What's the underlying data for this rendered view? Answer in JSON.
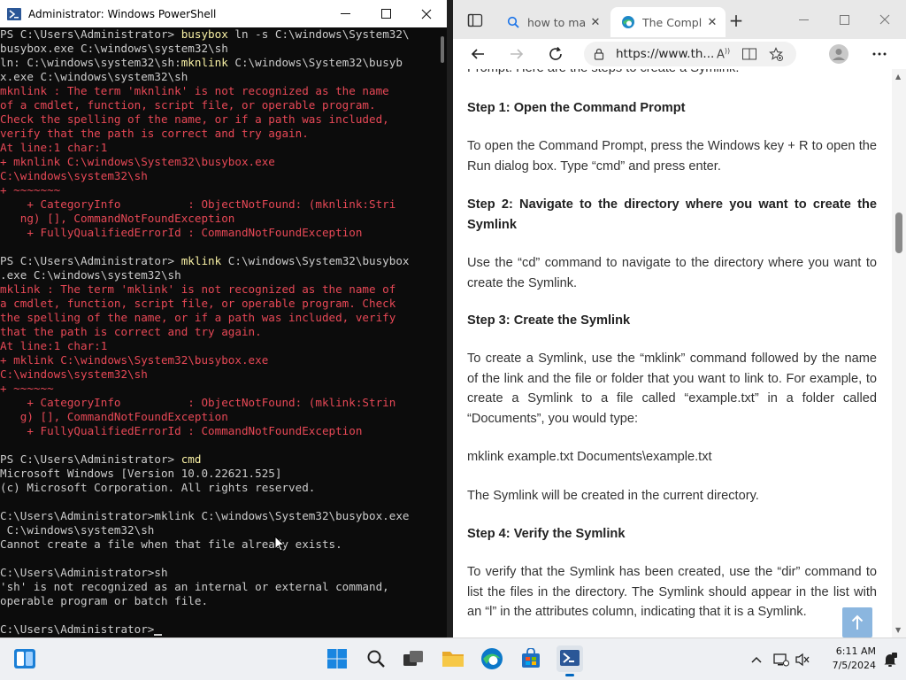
{
  "powershell": {
    "title": "Administrator: Windows PowerShell",
    "lines": [
      {
        "parts": [
          {
            "t": "PS C:\\Users\\Administrator> ",
            "c": "n"
          },
          {
            "t": "busybox ",
            "c": "y"
          },
          {
            "t": "ln -s C:\\windows\\System32\\",
            "c": "n"
          }
        ]
      },
      {
        "parts": [
          {
            "t": "busybox.exe C:\\windows\\system32\\sh",
            "c": "n"
          }
        ]
      },
      {
        "parts": [
          {
            "t": "ln: C:\\windows\\system32\\sh:",
            "c": "n"
          },
          {
            "t": "mknlink ",
            "c": "y"
          },
          {
            "t": "C:\\windows\\System32\\busyb",
            "c": "n"
          }
        ]
      },
      {
        "parts": [
          {
            "t": "x.exe C:\\windows\\system32\\sh",
            "c": "n"
          }
        ]
      },
      {
        "parts": [
          {
            "t": "mknlink : The term 'mknlink' is not recognized as the name",
            "c": "e"
          }
        ]
      },
      {
        "parts": [
          {
            "t": "of a cmdlet, function, script file, or operable program.",
            "c": "e"
          }
        ]
      },
      {
        "parts": [
          {
            "t": "Check the spelling of the name, or if a path was included,",
            "c": "e"
          }
        ]
      },
      {
        "parts": [
          {
            "t": "verify that the path is correct and try again.",
            "c": "e"
          }
        ]
      },
      {
        "parts": [
          {
            "t": "At line:1 char:1",
            "c": "e"
          }
        ]
      },
      {
        "parts": [
          {
            "t": "+ mknlink C:\\windows\\System32\\busybox.exe",
            "c": "e"
          }
        ]
      },
      {
        "parts": [
          {
            "t": "C:\\windows\\system32\\sh",
            "c": "e"
          }
        ]
      },
      {
        "parts": [
          {
            "t": "+ ~~~~~~~",
            "c": "e"
          }
        ]
      },
      {
        "parts": [
          {
            "t": "    + CategoryInfo          : ObjectNotFound: (mknlink:Stri",
            "c": "e"
          }
        ]
      },
      {
        "parts": [
          {
            "t": "   ng) [], CommandNotFoundException",
            "c": "e"
          }
        ]
      },
      {
        "parts": [
          {
            "t": "    + FullyQualifiedErrorId : CommandNotFoundException",
            "c": "e"
          }
        ]
      },
      {
        "parts": [
          {
            "t": "",
            "c": "n"
          }
        ]
      },
      {
        "parts": [
          {
            "t": "PS C:\\Users\\Administrator> ",
            "c": "n"
          },
          {
            "t": "mklink ",
            "c": "y"
          },
          {
            "t": "C:\\windows\\System32\\busybox",
            "c": "n"
          }
        ]
      },
      {
        "parts": [
          {
            "t": ".exe C:\\windows\\system32\\sh",
            "c": "n"
          }
        ]
      },
      {
        "parts": [
          {
            "t": "mklink : The term 'mklink' is not recognized as the name of",
            "c": "e"
          }
        ]
      },
      {
        "parts": [
          {
            "t": "a cmdlet, function, script file, or operable program. Check",
            "c": "e"
          }
        ]
      },
      {
        "parts": [
          {
            "t": "the spelling of the name, or if a path was included, verify",
            "c": "e"
          }
        ]
      },
      {
        "parts": [
          {
            "t": "that the path is correct and try again.",
            "c": "e"
          }
        ]
      },
      {
        "parts": [
          {
            "t": "At line:1 char:1",
            "c": "e"
          }
        ]
      },
      {
        "parts": [
          {
            "t": "+ mklink C:\\windows\\System32\\busybox.exe",
            "c": "e"
          }
        ]
      },
      {
        "parts": [
          {
            "t": "C:\\windows\\system32\\sh",
            "c": "e"
          }
        ]
      },
      {
        "parts": [
          {
            "t": "+ ~~~~~~",
            "c": "e"
          }
        ]
      },
      {
        "parts": [
          {
            "t": "    + CategoryInfo          : ObjectNotFound: (mklink:Strin",
            "c": "e"
          }
        ]
      },
      {
        "parts": [
          {
            "t": "   g) [], CommandNotFoundException",
            "c": "e"
          }
        ]
      },
      {
        "parts": [
          {
            "t": "    + FullyQualifiedErrorId : CommandNotFoundException",
            "c": "e"
          }
        ]
      },
      {
        "parts": [
          {
            "t": "",
            "c": "n"
          }
        ]
      },
      {
        "parts": [
          {
            "t": "PS C:\\Users\\Administrator> ",
            "c": "n"
          },
          {
            "t": "cmd",
            "c": "y"
          }
        ]
      },
      {
        "parts": [
          {
            "t": "Microsoft Windows [Version 10.0.22621.525]",
            "c": "n"
          }
        ]
      },
      {
        "parts": [
          {
            "t": "(c) Microsoft Corporation. All rights reserved.",
            "c": "n"
          }
        ]
      },
      {
        "parts": [
          {
            "t": "",
            "c": "n"
          }
        ]
      },
      {
        "parts": [
          {
            "t": "C:\\Users\\Administrator>mklink C:\\windows\\System32\\busybox.exe",
            "c": "n"
          }
        ]
      },
      {
        "parts": [
          {
            "t": " C:\\windows\\system32\\sh",
            "c": "n"
          }
        ]
      },
      {
        "parts": [
          {
            "t": "Cannot create a file when that file already exists.",
            "c": "n"
          }
        ]
      },
      {
        "parts": [
          {
            "t": "",
            "c": "n"
          }
        ]
      },
      {
        "parts": [
          {
            "t": "C:\\Users\\Administrator>sh",
            "c": "n"
          }
        ]
      },
      {
        "parts": [
          {
            "t": "'sh' is not recognized as an internal or external command,",
            "c": "n"
          }
        ]
      },
      {
        "parts": [
          {
            "t": "operable program or batch file.",
            "c": "n"
          }
        ]
      },
      {
        "parts": [
          {
            "t": "",
            "c": "n"
          }
        ]
      },
      {
        "parts": [
          {
            "t": "C:\\Users\\Administrator>",
            "c": "n"
          }
        ],
        "cursor": true
      }
    ]
  },
  "edge": {
    "tabs": [
      {
        "label": "how to ma",
        "icon": "search-icon"
      },
      {
        "label": "The Compl",
        "icon": "edge-globe-icon"
      }
    ],
    "address_url": "https://www.th...",
    "content": {
      "top_fragment": "Prompt. Here are the steps to create a Symlink:",
      "blocks": [
        {
          "type": "h",
          "text": "Step 1: Open the Command Prompt"
        },
        {
          "type": "p",
          "text": "To open the Command Prompt, press the Windows key + R to open the Run dialog box. Type “cmd” and press enter."
        },
        {
          "type": "h",
          "text": "Step 2: Navigate to the directory where you want to create the Symlink"
        },
        {
          "type": "p",
          "text": "Use the “cd” command to navigate to the directory where you want to create the Symlink."
        },
        {
          "type": "h",
          "text": "Step 3: Create the Symlink"
        },
        {
          "type": "p",
          "text": "To create a Symlink, use the “mklink” command followed by the name of the link and the file or folder that you want to link to. For example, to create a Symlink to a file called “example.txt” in a folder called “Documents”, you would type:"
        },
        {
          "type": "p",
          "text": "mklink example.txt Documents\\example.txt"
        },
        {
          "type": "p",
          "text": "The Symlink will be created in the current directory."
        },
        {
          "type": "h",
          "text": "Step 4: Verify the Symlink"
        },
        {
          "type": "p",
          "text": "To verify that the Symlink has been created, use the “dir” command to list the files in the directory. The Symlink should appear in the list with an “l” in the attributes column, indicating that it is a Symlink."
        }
      ]
    }
  },
  "taskbar": {
    "clock_time": "6:11 AM",
    "clock_date": "7/5/2024"
  }
}
